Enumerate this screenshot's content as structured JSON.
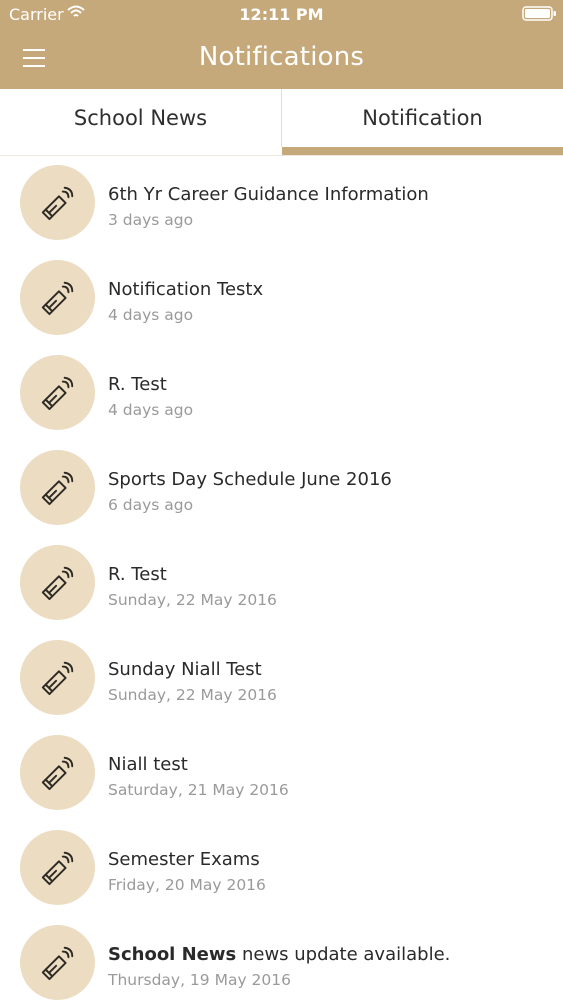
{
  "status_bar": {
    "carrier": "Carrier",
    "time": "12:11 PM"
  },
  "header": {
    "title": "Notifications",
    "menu_icon": "hamburger-menu-icon",
    "background_color": "#c6a97b"
  },
  "tabs": [
    {
      "label": "School News",
      "active": false
    },
    {
      "label": "Notification",
      "active": true
    }
  ],
  "notifications": [
    {
      "title": "6th Yr Career Guidance Information",
      "time": "3 days ago",
      "icon": "megaphone-icon"
    },
    {
      "title": "Notification Testx",
      "time": "4 days ago",
      "icon": "megaphone-icon"
    },
    {
      "title": "R. Test",
      "time": "4 days ago",
      "icon": "megaphone-icon"
    },
    {
      "title": "Sports Day Schedule June 2016",
      "time": "6 days ago",
      "icon": "megaphone-icon"
    },
    {
      "title": "R. Test",
      "time": "Sunday, 22 May 2016",
      "icon": "megaphone-icon"
    },
    {
      "title": "Sunday Niall Test",
      "time": "Sunday, 22 May 2016",
      "icon": "megaphone-icon"
    },
    {
      "title": "Niall test",
      "time": "Saturday, 21 May 2016",
      "icon": "megaphone-icon"
    },
    {
      "title": "Semester Exams",
      "time": "Friday, 20 May 2016",
      "icon": "megaphone-icon"
    },
    {
      "title_bold": "School News",
      "title_rest": " news update available.",
      "time": "Thursday, 19 May 2016",
      "icon": "megaphone-icon"
    }
  ],
  "colors": {
    "accent": "#c6a97b",
    "avatar_background": "#ecdcc2",
    "secondary_text": "#9a9a9a"
  }
}
